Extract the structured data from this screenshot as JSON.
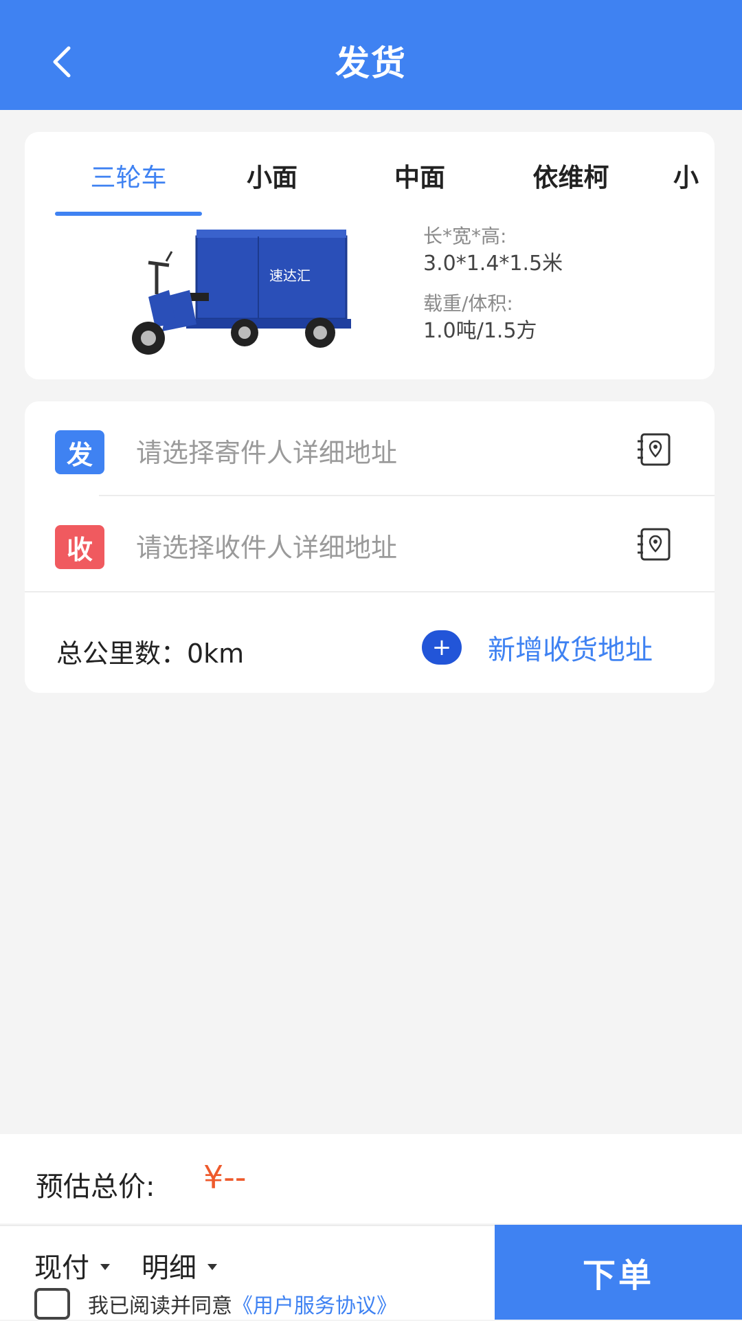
{
  "header": {
    "title": "发货",
    "back_icon": "chevron-left-icon"
  },
  "vehicle": {
    "tabs": [
      {
        "label": "三轮车",
        "active": true
      },
      {
        "label": "小面",
        "active": false
      },
      {
        "label": "中面",
        "active": false
      },
      {
        "label": "依维柯",
        "active": false
      },
      {
        "label": "小",
        "active": false
      }
    ],
    "image_brand": "速达汇",
    "size_label": "长*宽*高:",
    "size_value": "3.0*1.4*1.5米",
    "load_label": "载重/体积:",
    "load_value": "1.0吨/1.5方"
  },
  "address": {
    "send_badge": "发",
    "send_placeholder": "请选择寄件人详细地址",
    "recv_badge": "收",
    "recv_placeholder": "请选择收件人详细地址",
    "book_icon": "address-book-icon",
    "distance": "总公里数：0km",
    "add_plus": "+",
    "add_label": "新增收货地址"
  },
  "price": {
    "label": "预估总价:",
    "value": "¥--"
  },
  "footer": {
    "payment": "现付",
    "detail": "明细",
    "agree_text": "我已阅读并同意",
    "agree_link": "《用户服务协议》",
    "order_button": "下单"
  },
  "colors": {
    "primary": "#3f82f2",
    "send_badge": "#3f82f2",
    "recv_badge": "#f05a5f",
    "price": "#ee5a2c"
  }
}
